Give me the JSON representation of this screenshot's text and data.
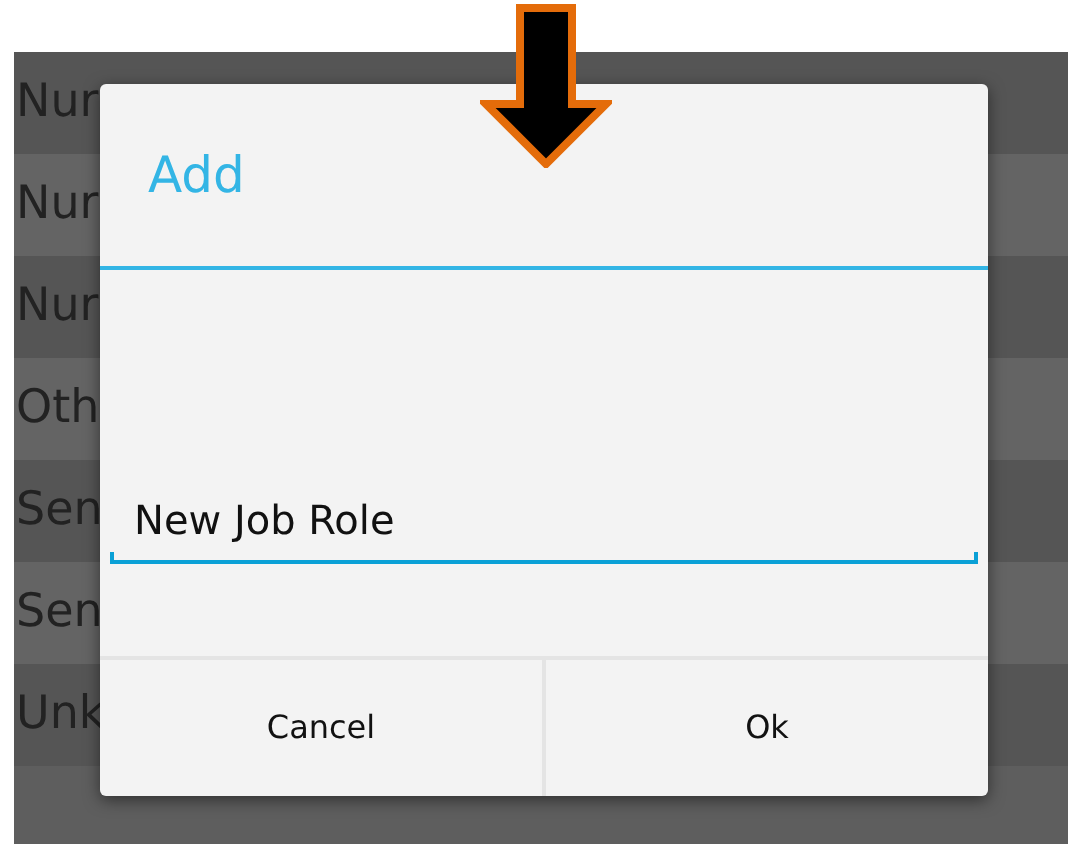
{
  "list": {
    "rows": [
      {
        "label": "Nur"
      },
      {
        "label": "Nur"
      },
      {
        "label": "Nur"
      },
      {
        "label": "Oth"
      },
      {
        "label": "Sen"
      },
      {
        "label": "Sen"
      },
      {
        "label": "Unk"
      }
    ]
  },
  "dialog": {
    "title": "Add",
    "field": {
      "value": "New Job Role"
    },
    "buttons": [
      "Cancel",
      "Ok"
    ]
  }
}
